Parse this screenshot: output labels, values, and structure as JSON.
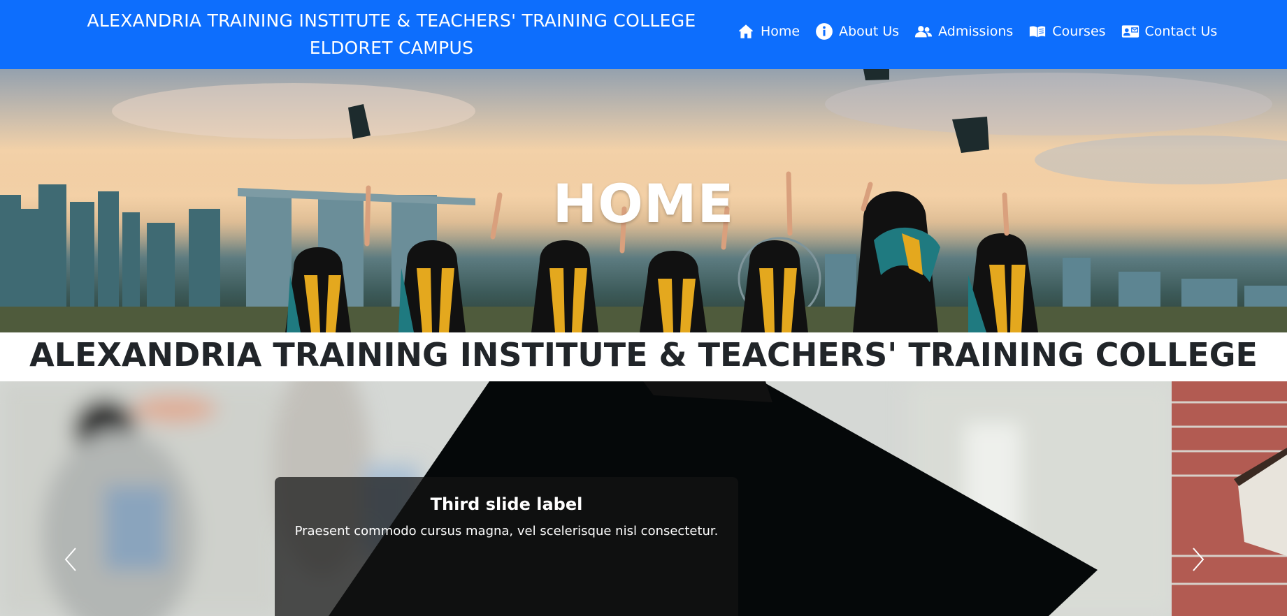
{
  "navbar": {
    "brand_line1": "ALEXANDRIA TRAINING INSTITUTE & TEACHERS' TRAINING COLLEGE",
    "brand_line2": "ELDORET CAMPUS",
    "links": [
      {
        "label": "Home",
        "icon": "home-icon"
      },
      {
        "label": "About Us",
        "icon": "info-icon"
      },
      {
        "label": "Admissions",
        "icon": "users-icon"
      },
      {
        "label": "Courses",
        "icon": "book-icon"
      },
      {
        "label": "Contact Us",
        "icon": "contact-card-icon"
      }
    ],
    "bg_color": "#0d6efd"
  },
  "hero": {
    "title": "HOME"
  },
  "heading": {
    "text": "ALEXANDRIA TRAINING INSTITUTE & TEACHERS' TRAINING COLLEGE"
  },
  "carousel": {
    "caption_title": "Third slide label",
    "caption_text": "Praesent commodo cursus magna, vel scelerisque nisl consectetur.",
    "prev_icon": "chevron-left-icon",
    "next_icon": "chevron-right-icon"
  }
}
